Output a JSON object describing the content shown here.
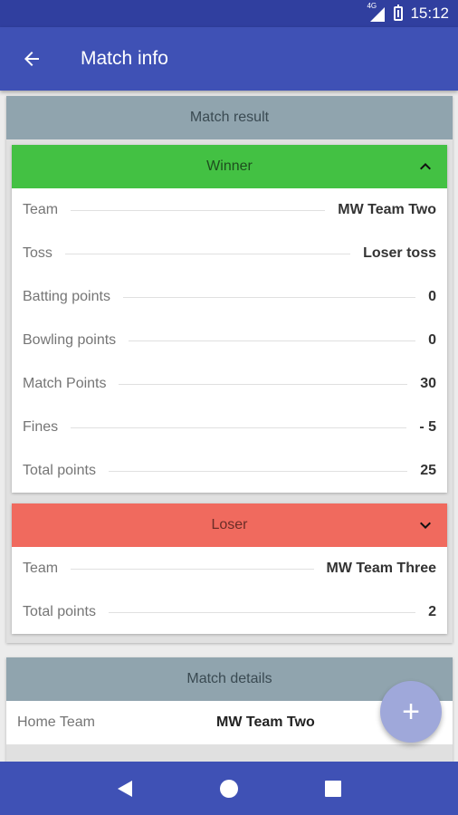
{
  "status": {
    "network": "4G",
    "time": "15:12"
  },
  "appbar": {
    "title": "Match info"
  },
  "match_result": {
    "title": "Match result",
    "winner": {
      "label": "Winner",
      "rows": [
        {
          "key": "Team",
          "value": "MW Team Two"
        },
        {
          "key": "Toss",
          "value": "Loser toss"
        },
        {
          "key": "Batting points",
          "value": "0"
        },
        {
          "key": "Bowling points",
          "value": "0"
        },
        {
          "key": "Match Points",
          "value": "30"
        },
        {
          "key": "Fines",
          "value": "- 5"
        },
        {
          "key": "Total points",
          "value": "25"
        }
      ]
    },
    "loser": {
      "label": "Loser",
      "rows": [
        {
          "key": "Team",
          "value": "MW Team Three"
        },
        {
          "key": "Total points",
          "value": "2"
        }
      ]
    }
  },
  "match_details": {
    "title": "Match details",
    "rows": [
      {
        "key": "Home Team",
        "value": "MW Team Two"
      }
    ]
  },
  "fab": {
    "label": "+"
  },
  "colors": {
    "primary": "#3f51b5",
    "primary_dark": "#303f9f",
    "winner": "#43c143",
    "loser": "#f06a5e",
    "card_header": "#90a4ae",
    "fab": "#9fa8da"
  }
}
